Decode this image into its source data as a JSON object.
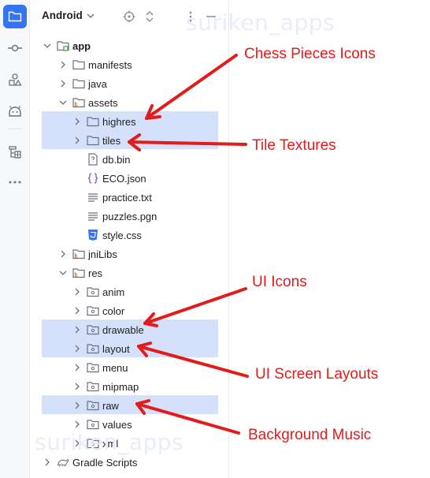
{
  "header": {
    "view_label": "Android"
  },
  "watermarks": [
    "suriken_apps",
    "suriken_apps"
  ],
  "tree": [
    {
      "label": "app",
      "icon": "module-folder-icon",
      "bold": true
    },
    {
      "label": "manifests",
      "icon": "folder-icon"
    },
    {
      "label": "java",
      "icon": "folder-icon"
    },
    {
      "label": "assets",
      "icon": "resource-folder-icon"
    },
    {
      "label": "highres",
      "icon": "folder-icon"
    },
    {
      "label": "tiles",
      "icon": "folder-icon"
    },
    {
      "label": "db.bin",
      "icon": "unknown-file-icon"
    },
    {
      "label": "ECO.json",
      "icon": "json-file-icon"
    },
    {
      "label": "practice.txt",
      "icon": "text-file-icon"
    },
    {
      "label": "puzzles.pgn",
      "icon": "text-file-icon"
    },
    {
      "label": "style.css",
      "icon": "css-file-icon"
    },
    {
      "label": "jniLibs",
      "icon": "resource-folder-icon"
    },
    {
      "label": "res",
      "icon": "resource-folder-icon"
    },
    {
      "label": "anim",
      "icon": "res-subfolder-icon"
    },
    {
      "label": "color",
      "icon": "res-subfolder-icon"
    },
    {
      "label": "drawable",
      "icon": "res-subfolder-icon"
    },
    {
      "label": "layout",
      "icon": "res-subfolder-icon"
    },
    {
      "label": "menu",
      "icon": "res-subfolder-icon"
    },
    {
      "label": "mipmap",
      "icon": "res-subfolder-icon"
    },
    {
      "label": "raw",
      "icon": "res-subfolder-icon"
    },
    {
      "label": "values",
      "icon": "res-subfolder-icon"
    },
    {
      "label": "xml",
      "icon": "res-subfolder-icon"
    },
    {
      "label": "Gradle Scripts",
      "icon": "gradle-icon"
    }
  ],
  "annotations": [
    {
      "text": "Chess Pieces Icons"
    },
    {
      "text": "Tile Textures"
    },
    {
      "text": "UI Icons"
    },
    {
      "text": "UI Screen Layouts"
    },
    {
      "text": "Background Music"
    }
  ],
  "colors": {
    "accent": "#3574f0",
    "selection": "#d5e1fb",
    "annotation": "#e21b1b"
  }
}
